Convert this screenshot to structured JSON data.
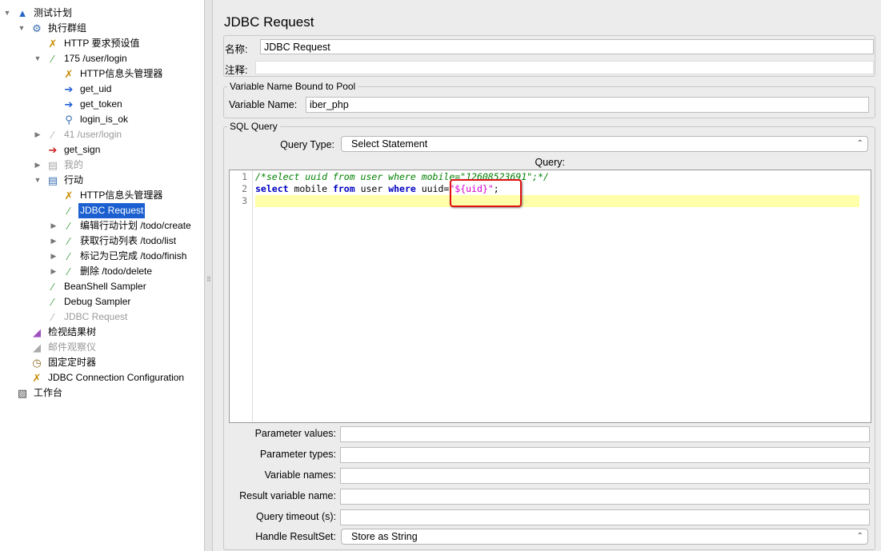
{
  "tree": [
    {
      "label": "测试计划",
      "level": 0,
      "toggle": "expanded",
      "icon": "flask-icon",
      "state": "normal"
    },
    {
      "label": "执行群组",
      "level": 1,
      "toggle": "expanded",
      "icon": "gear-icon",
      "state": "normal"
    },
    {
      "label": "HTTP 要求预设值",
      "level": 2,
      "toggle": "none",
      "icon": "tools-icon",
      "state": "normal"
    },
    {
      "label": "175 /user/login",
      "level": 2,
      "toggle": "expanded",
      "icon": "pipette-icon",
      "state": "normal"
    },
    {
      "label": "HTTP信息头管理器",
      "level": 3,
      "toggle": "none",
      "icon": "tools-icon",
      "state": "normal"
    },
    {
      "label": "get_uid",
      "level": 3,
      "toggle": "none",
      "icon": "extractor-icon",
      "state": "normal"
    },
    {
      "label": "get_token",
      "level": 3,
      "toggle": "none",
      "icon": "extractor-icon",
      "state": "normal"
    },
    {
      "label": "login_is_ok",
      "level": 3,
      "toggle": "none",
      "icon": "magnifier-icon",
      "state": "normal"
    },
    {
      "label": "41 /user/login",
      "level": 2,
      "toggle": "collapsed",
      "icon": "pipette-icon",
      "state": "disabled"
    },
    {
      "label": "get_sign",
      "level": 2,
      "toggle": "none",
      "icon": "preprocessor-icon",
      "state": "normal"
    },
    {
      "label": "我的",
      "level": 2,
      "toggle": "collapsed",
      "icon": "controller-icon",
      "state": "disabled"
    },
    {
      "label": "行动",
      "level": 2,
      "toggle": "expanded",
      "icon": "controller-icon",
      "state": "normal"
    },
    {
      "label": "HTTP信息头管理器",
      "level": 3,
      "toggle": "none",
      "icon": "tools-icon",
      "state": "normal"
    },
    {
      "label": "JDBC Request",
      "level": 3,
      "toggle": "none",
      "icon": "pipette-icon",
      "state": "selected"
    },
    {
      "label": "编辑行动计划 /todo/create",
      "level": 3,
      "toggle": "collapsed",
      "icon": "pipette-icon",
      "state": "normal"
    },
    {
      "label": "获取行动列表 /todo/list",
      "level": 3,
      "toggle": "collapsed",
      "icon": "pipette-icon",
      "state": "normal"
    },
    {
      "label": "标记为已完成 /todo/finish",
      "level": 3,
      "toggle": "collapsed",
      "icon": "pipette-icon",
      "state": "normal"
    },
    {
      "label": "删除 /todo/delete",
      "level": 3,
      "toggle": "collapsed",
      "icon": "pipette-icon",
      "state": "normal"
    },
    {
      "label": "BeanShell Sampler",
      "level": 2,
      "toggle": "none",
      "icon": "pipette-icon",
      "state": "normal"
    },
    {
      "label": "Debug Sampler",
      "level": 2,
      "toggle": "none",
      "icon": "pipette-icon",
      "state": "normal"
    },
    {
      "label": "JDBC Request",
      "level": 2,
      "toggle": "none",
      "icon": "pipette-icon",
      "state": "disabled"
    },
    {
      "label": "检视结果树",
      "level": 1,
      "toggle": "none",
      "icon": "chart-icon",
      "state": "normal"
    },
    {
      "label": "邮件观察仪",
      "level": 1,
      "toggle": "none",
      "icon": "chart-icon",
      "state": "disabled"
    },
    {
      "label": "固定定时器",
      "level": 1,
      "toggle": "none",
      "icon": "timer-icon",
      "state": "normal"
    },
    {
      "label": "JDBC Connection Configuration",
      "level": 1,
      "toggle": "none",
      "icon": "tools-icon",
      "state": "normal"
    },
    {
      "label": "工作台",
      "level": 0,
      "toggle": "none",
      "icon": "workbench-icon",
      "state": "normal"
    }
  ],
  "panel": {
    "title": "JDBC Request",
    "name_label": "名称:",
    "name_value": "JDBC Request",
    "comment_label": "注释:",
    "comment_value": "",
    "pool_legend": "Variable Name Bound to Pool",
    "pool_label": "Variable Name:",
    "pool_value": "iber_php",
    "sql_legend": "SQL Query",
    "query_type_label": "Query Type:",
    "query_type_value": "Select Statement",
    "query_label": "Query:",
    "lines": [
      "1",
      "2",
      "3"
    ],
    "line1": "/*select uuid from user where mobile=\"12608523691\";*/",
    "line2": {
      "k1": "select",
      "t1": " mobile ",
      "k2": "from",
      "t2": " user ",
      "k3": "where",
      "t3": " uuid=",
      "s": "\"${uid}\"",
      "t4": ";"
    },
    "fields": [
      {
        "label": "Parameter values:",
        "value": ""
      },
      {
        "label": "Parameter types:",
        "value": ""
      },
      {
        "label": "Variable names:",
        "value": ""
      },
      {
        "label": "Result variable name:",
        "value": ""
      },
      {
        "label": "Query timeout (s):",
        "value": ""
      }
    ],
    "resultset_label": "Handle ResultSet:",
    "resultset_value": "Store as String"
  },
  "colors": {
    "selection": "#1b5fd0",
    "highlight_box": "#e01010",
    "current_line": "#ffffaa"
  }
}
